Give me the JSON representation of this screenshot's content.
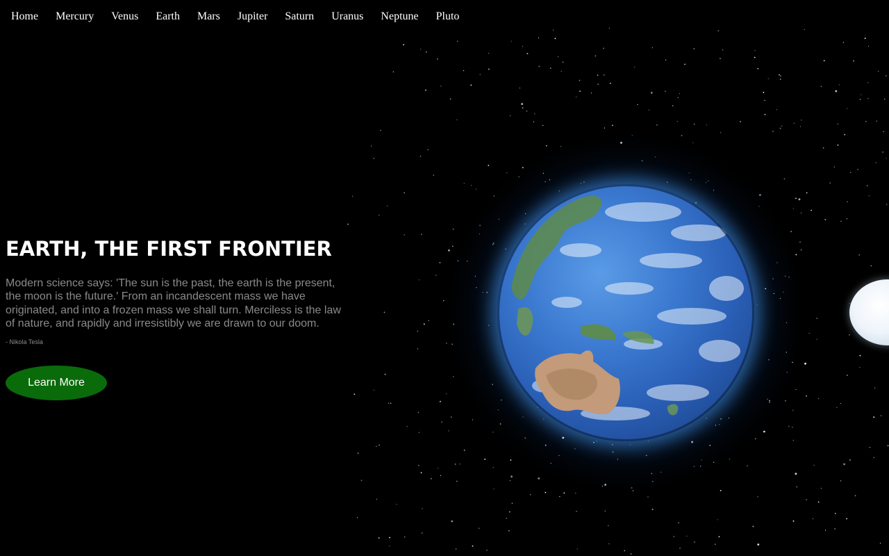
{
  "nav": {
    "items": [
      {
        "label": "Home"
      },
      {
        "label": "Mercury"
      },
      {
        "label": "Venus"
      },
      {
        "label": "Earth"
      },
      {
        "label": "Mars"
      },
      {
        "label": "Jupiter"
      },
      {
        "label": "Saturn"
      },
      {
        "label": "Uranus"
      },
      {
        "label": "Neptune"
      },
      {
        "label": "Pluto"
      }
    ]
  },
  "hero": {
    "title": "EARTH, THE FIRST FRONTIER",
    "quote": "Modern science says: 'The sun is the past, the earth is the present, the moon is the future.' From an incandescent mass we have originated, and into a frozen mass we shall turn. Merciless is the law of nature, and rapidly and irresistibly we are drawn to our doom.",
    "author": "- Nikola Tesla",
    "button_label": "Learn More"
  },
  "colors": {
    "background": "#000000",
    "button": "#0a6b0a",
    "quote_text": "#8a8a8a",
    "earth_glow": "#46a0ff"
  },
  "icons": {
    "earth": "earth-globe-image",
    "moon": "moon-image",
    "stars": "starfield-background"
  }
}
